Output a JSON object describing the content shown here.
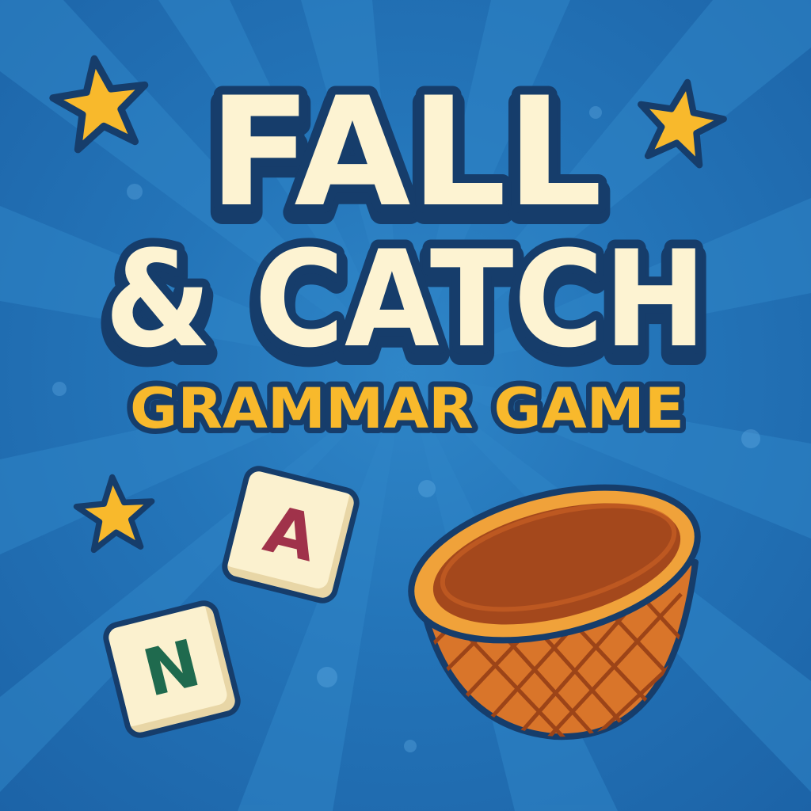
{
  "title": {
    "line1": "FALL",
    "line2": "& CATCH",
    "subtitle": "GRAMMAR GAME"
  },
  "letter_tiles": [
    {
      "letter": "A",
      "color": "#a0324a"
    },
    {
      "letter": "N",
      "color": "#1f6a4e"
    }
  ],
  "colors": {
    "background": "#2475b9",
    "title_fill": "#fdf3d2",
    "title_outline": "#163d6b",
    "subtitle_fill": "#f8b92c",
    "star": "#f8b92c",
    "basket_rim": "#f0a23a",
    "basket_body": "#d9752a",
    "basket_inside": "#a4481c"
  },
  "icons": [
    "star-icon",
    "basket-icon",
    "letter-tile-icon"
  ]
}
